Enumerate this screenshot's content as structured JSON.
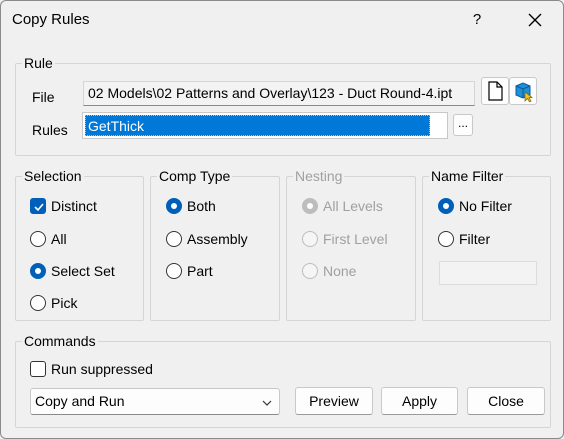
{
  "window": {
    "title": "Copy Rules",
    "help": "?"
  },
  "rule": {
    "legend": "Rule",
    "file_label": "File",
    "file_value": "02 Models\\02 Patterns and Overlay\\123 - Duct Round-4.ipt",
    "rules_label": "Rules",
    "rules_value": "GetThick",
    "browse_label": "..."
  },
  "selection": {
    "legend": "Selection",
    "distinct_label": "Distinct",
    "distinct_checked": true,
    "options": [
      "All",
      "Select Set",
      "Pick"
    ],
    "selected": "Select Set"
  },
  "comp_type": {
    "legend": "Comp Type",
    "options": [
      "Both",
      "Assembly",
      "Part"
    ],
    "selected": "Both"
  },
  "nesting": {
    "legend": "Nesting",
    "enabled": false,
    "options": [
      "All Levels",
      "First Level",
      "None"
    ],
    "selected": "All Levels"
  },
  "name_filter": {
    "legend": "Name Filter",
    "options": [
      "No Filter",
      "Filter"
    ],
    "selected": "No Filter",
    "filter_text": ""
  },
  "commands": {
    "legend": "Commands",
    "run_suppressed_label": "Run suppressed",
    "run_suppressed_checked": false,
    "mode_value": "Copy and Run",
    "buttons": {
      "preview": "Preview",
      "apply": "Apply",
      "close": "Close"
    }
  },
  "colors": {
    "accent": "#005fb8",
    "selection": "#0078d7",
    "background": "#f0f0f0"
  },
  "icons": [
    "document-icon",
    "cube-select-icon",
    "close-icon",
    "chevron-down-icon",
    "checkmark-icon"
  ]
}
